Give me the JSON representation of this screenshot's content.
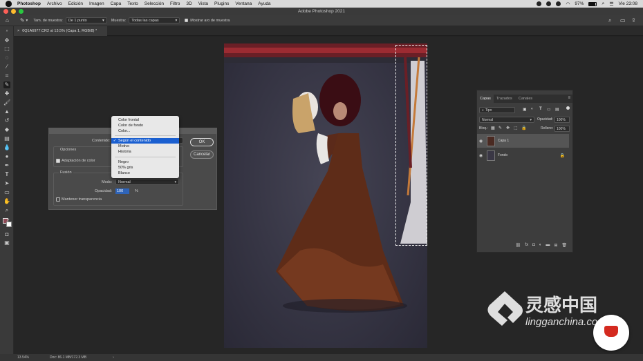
{
  "menubar": {
    "app": "Photoshop",
    "items": [
      "Archivo",
      "Edición",
      "Imagen",
      "Capa",
      "Texto",
      "Selección",
      "Filtro",
      "3D",
      "Vista",
      "Plugins",
      "Ventana",
      "Ayuda"
    ],
    "battery": "97%",
    "clock": "Vie 23:08"
  },
  "window": {
    "title": "Adobe Photoshop 2021"
  },
  "options": {
    "sample_size_label": "Tam. de muestra:",
    "sample_size_value": "De 1 punto",
    "sample_label": "Muestra:",
    "sample_value": "Todas las capas",
    "show_ring_label": "Mostrar aro de muestra"
  },
  "document_tab": "0Q1A6977.CR2 al 13.5% (Capa 1, RGB/8) *",
  "status": {
    "zoom": "13.54%",
    "doc": "Doc: 86.1 MB/172.3 MB"
  },
  "fill_dialog": {
    "contents_label": "Contenido:",
    "options_heading": "Opciones",
    "color_adaptation_label": "Adaptación de color",
    "blending_heading": "Fusión",
    "mode_label": "Modo:",
    "mode_value": "Normal",
    "opacity_label": "Opacidad:",
    "opacity_value": "100",
    "opacity_unit": "%",
    "preserve_label": "Mantener transparencia",
    "ok": "OK",
    "cancel": "Cancelar"
  },
  "contents_menu": {
    "items": [
      "Color frontal",
      "Color de fondo",
      "Color...",
      "Según el contenido",
      "Motivo",
      "Historia",
      "Negro",
      "50% gris",
      "Blanco"
    ],
    "selected": "Según el contenido",
    "checkmark": "✓"
  },
  "layers_panel": {
    "tabs": [
      "Capas",
      "Trazados",
      "Canales"
    ],
    "filter_value": "Tipo",
    "blend_value": "Normal",
    "opacity_label": "Opacidad:",
    "opacity_value": "100%",
    "lock_label": "Bloq.:",
    "fill_label": "Relleno:",
    "fill_value": "100%",
    "layers": [
      {
        "name": "Capa 1",
        "selected": true
      },
      {
        "name": "Fondo",
        "selected": false
      }
    ]
  },
  "watermark": {
    "title": "灵感中国",
    "url": "lingganchina.com"
  }
}
